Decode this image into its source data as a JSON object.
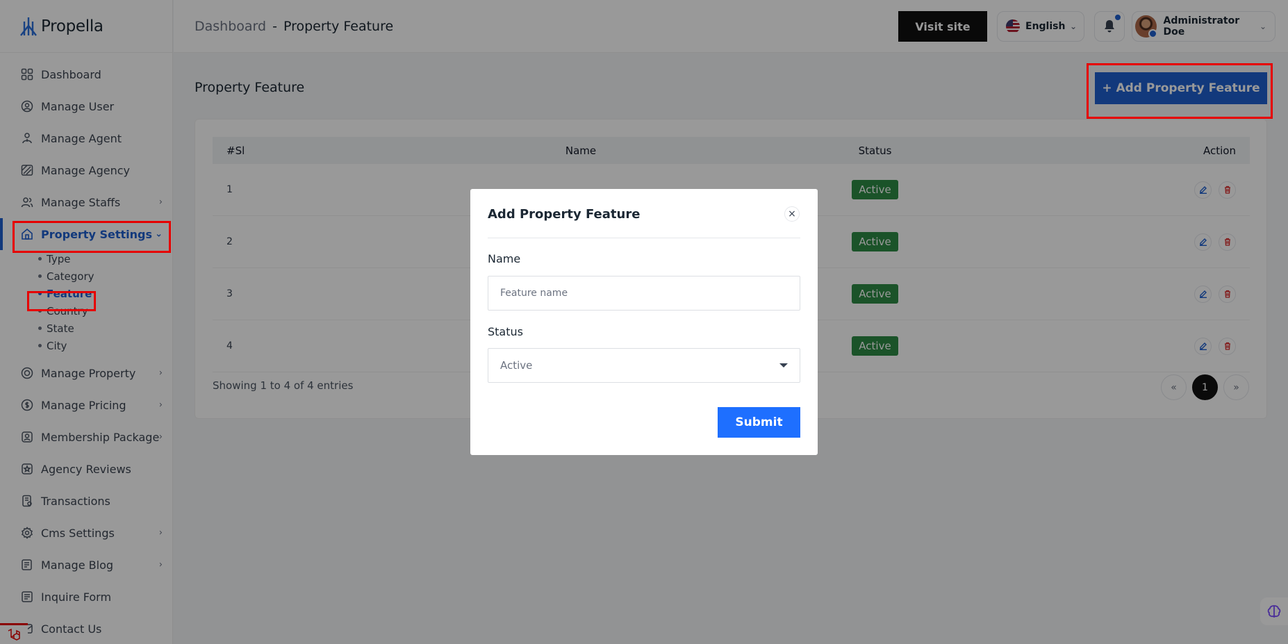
{
  "brand": {
    "name": "Propella"
  },
  "sidebar": {
    "items": [
      {
        "label": "Dashboard",
        "icon": "grid-icon",
        "has_children": false
      },
      {
        "label": "Manage User",
        "icon": "user-circle-icon",
        "has_children": false
      },
      {
        "label": "Manage Agent",
        "icon": "agent-icon",
        "has_children": false
      },
      {
        "label": "Manage Agency",
        "icon": "agency-icon",
        "has_children": false
      },
      {
        "label": "Manage Staffs",
        "icon": "users-icon",
        "has_children": true
      },
      {
        "label": "Property Settings",
        "icon": "home-icon",
        "has_children": true,
        "active": true
      },
      {
        "label": "Manage Property",
        "icon": "property-icon",
        "has_children": true
      },
      {
        "label": "Manage Pricing",
        "icon": "pricing-icon",
        "has_children": true
      },
      {
        "label": "Membership Package",
        "icon": "package-icon",
        "has_children": true
      },
      {
        "label": "Agency Reviews",
        "icon": "review-icon",
        "has_children": false
      },
      {
        "label": "Transactions",
        "icon": "transaction-icon",
        "has_children": false
      },
      {
        "label": "Cms Settings",
        "icon": "settings-icon",
        "has_children": true
      },
      {
        "label": "Manage Blog",
        "icon": "blog-icon",
        "has_children": true
      },
      {
        "label": "Inquire Form",
        "icon": "form-icon",
        "has_children": false
      },
      {
        "label": "Contact Us",
        "icon": "contact-icon",
        "has_children": false
      }
    ],
    "sub_items": [
      "Type",
      "Category",
      "Feature",
      "Country",
      "State",
      "City"
    ],
    "active_sub": "Feature"
  },
  "header": {
    "breadcrumb_link": "Dashboard",
    "breadcrumb_sep": "-",
    "breadcrumb_current": "Property Feature",
    "visit_site": "Visit site",
    "language": "English",
    "user_name": "Administrator Doe"
  },
  "main": {
    "title": "Property Feature",
    "add_button": "+ Add Property Feature",
    "table": {
      "headers": [
        "#Sl",
        "Name",
        "Status",
        "Action"
      ],
      "rows": [
        {
          "sl": "1",
          "name": "",
          "status": "Active"
        },
        {
          "sl": "2",
          "name": "",
          "status": "Active"
        },
        {
          "sl": "3",
          "name": "",
          "status": "Active"
        },
        {
          "sl": "4",
          "name": "",
          "status": "Active"
        }
      ]
    },
    "showing": "Showing 1 to 4 of 4 entries",
    "pagination": {
      "prev": "«",
      "current": "1",
      "next": "»"
    }
  },
  "modal": {
    "title": "Add Property Feature",
    "close": "×",
    "name_label": "Name",
    "name_placeholder": "Feature name",
    "name_value": "",
    "status_label": "Status",
    "status_value": "Active",
    "submit": "Submit"
  },
  "colors": {
    "primary": "#1e5fcf",
    "active_badge": "#2e8b45",
    "highlight": "#e60000",
    "submit": "#1e6fff"
  }
}
